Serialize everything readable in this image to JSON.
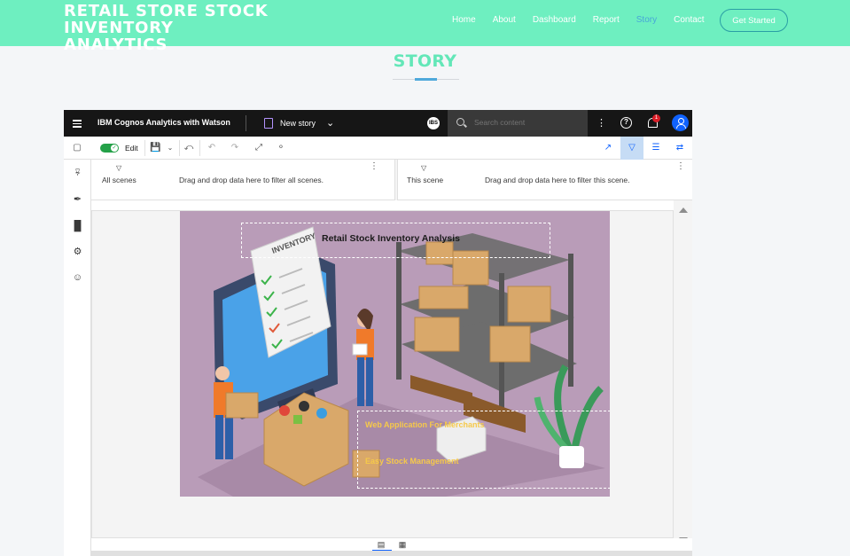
{
  "site": {
    "logo": "RETAIL STORE STOCK INVENTORY\nANALYTICS",
    "nav": [
      {
        "label": "Home",
        "active": false
      },
      {
        "label": "About",
        "active": false
      },
      {
        "label": "Dashboard",
        "active": false
      },
      {
        "label": "Report",
        "active": false
      },
      {
        "label": "Story",
        "active": true
      },
      {
        "label": "Contact",
        "active": false
      }
    ],
    "cta_label": "Get Started",
    "section_title": "STORY",
    "colors": {
      "header": "#6eefc0",
      "active_nav": "#47a6d8",
      "title": "#63e7b8"
    }
  },
  "cognos": {
    "app_name": "IBM Cognos Analytics with Watson",
    "story_name": "New story",
    "avatar_badge": "IBS",
    "search_placeholder": "Search content",
    "notification_count": "1",
    "toolbar": {
      "edit_label": "Edit",
      "edit_on": true
    },
    "filters": {
      "all_title": "All scenes",
      "all_hint": "Drag and drop data here to filter all scenes.",
      "this_title": "This scene",
      "this_hint": "Drag and drop data here to filter this scene."
    },
    "scene": {
      "title": "Retail Stock Inventory Analysis",
      "line1": "Web Application For Merchants",
      "line2": "Easy Stock Management",
      "illustration_text": "INVENTORY"
    }
  }
}
